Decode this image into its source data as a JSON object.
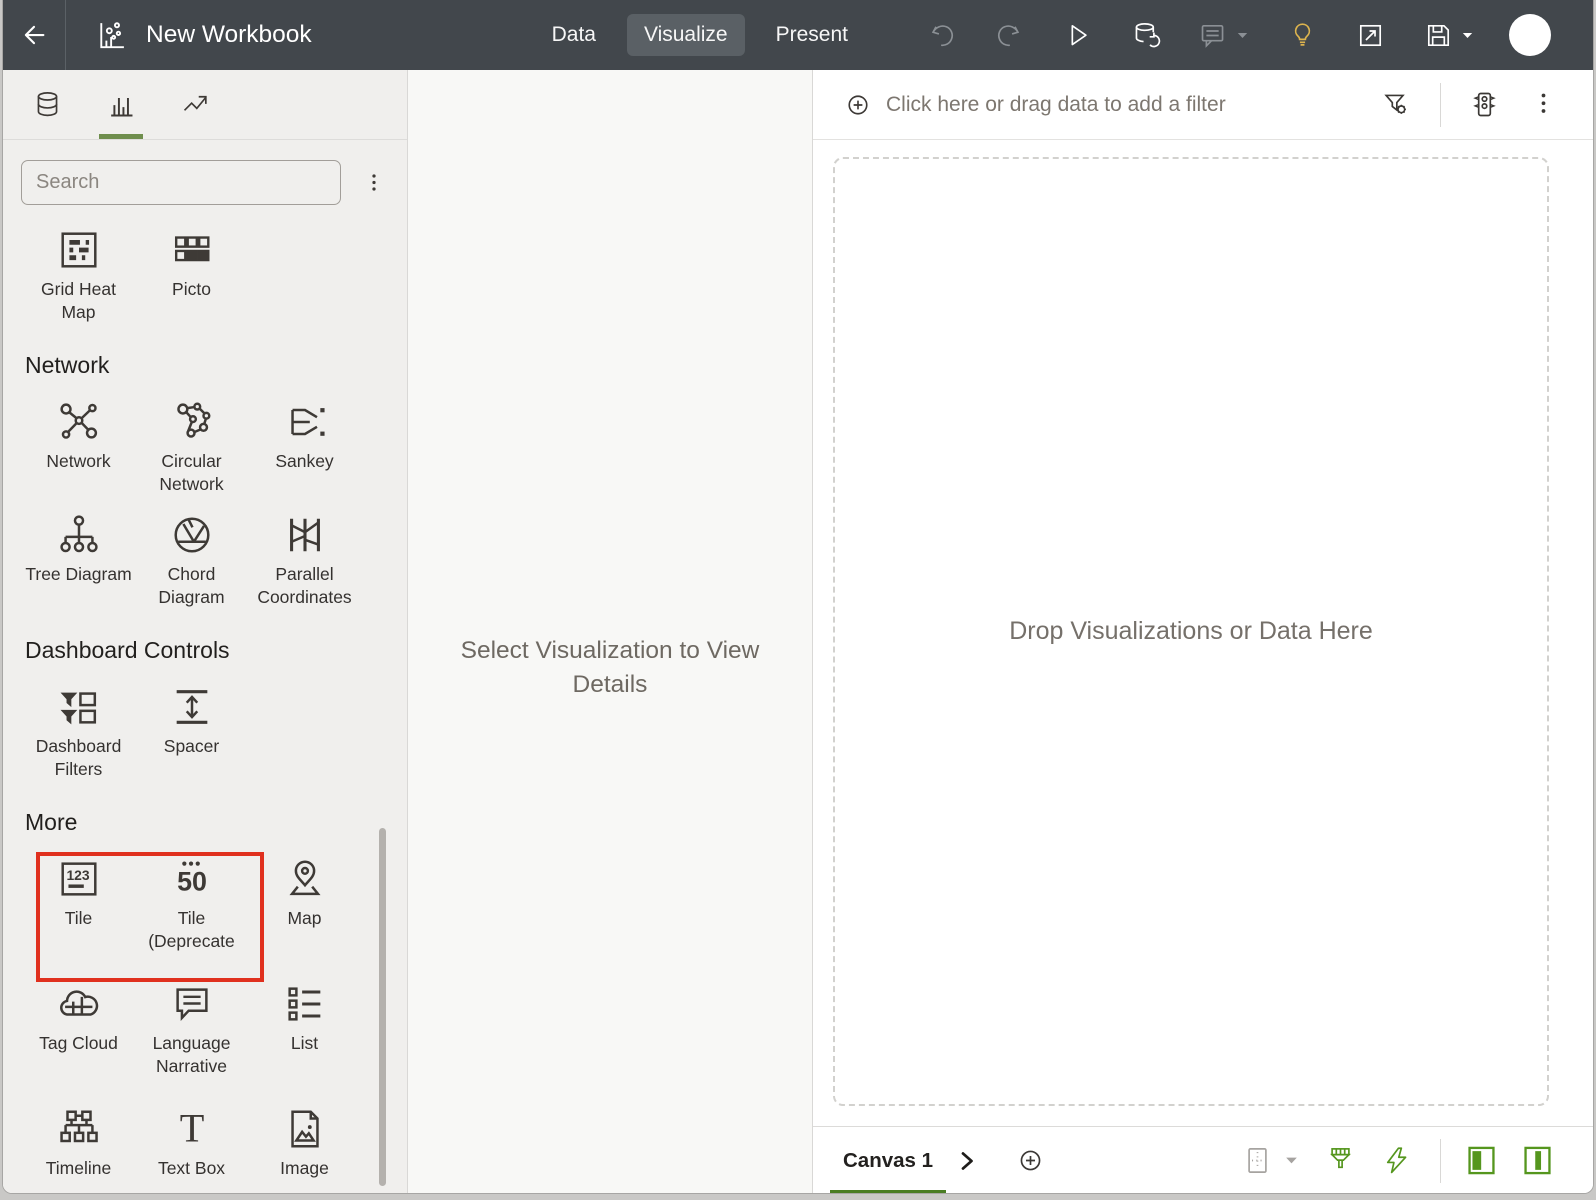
{
  "colors": {
    "topbar_bg": "#42474c",
    "accent_green": "#4a7d23",
    "sidebar_tab_green": "#6f8e4d",
    "toolbar_green": "#55961e",
    "highlight_red": "#e0301e",
    "insight_yellow": "#ddb44e"
  },
  "topbar": {
    "title": "New Workbook",
    "tabs": [
      {
        "label": "Data",
        "selected": false
      },
      {
        "label": "Visualize",
        "selected": true
      },
      {
        "label": "Present",
        "selected": false
      }
    ],
    "actions": [
      {
        "icon": "undo",
        "enabled": false
      },
      {
        "icon": "redo",
        "enabled": false
      },
      {
        "icon": "run",
        "enabled": true
      },
      {
        "icon": "refresh-data",
        "enabled": true
      },
      {
        "icon": "comment",
        "enabled": false,
        "caret": true
      },
      {
        "icon": "insight",
        "enabled": true,
        "yellow": true
      },
      {
        "icon": "open-window",
        "enabled": true
      },
      {
        "icon": "save",
        "enabled": true,
        "caret": true
      }
    ]
  },
  "sidebar": {
    "tabs": [
      {
        "icon": "data-panel",
        "selected": false
      },
      {
        "icon": "visualizations",
        "selected": true
      },
      {
        "icon": "analytics",
        "selected": false
      }
    ],
    "search_placeholder": "Search",
    "sections": [
      {
        "heading": "",
        "items": [
          {
            "label": "Grid Heat Map",
            "icon": "grid-heat-map"
          },
          {
            "label": "Picto",
            "icon": "picto"
          }
        ]
      },
      {
        "heading": "Network",
        "items": [
          {
            "label": "Network",
            "icon": "network"
          },
          {
            "label": "Circular Network",
            "icon": "circular-network"
          },
          {
            "label": "Sankey",
            "icon": "sankey"
          },
          {
            "label": "Tree Diagram",
            "icon": "tree-diagram"
          },
          {
            "label": "Chord Diagram",
            "icon": "chord-diagram"
          },
          {
            "label": "Parallel Coordinates",
            "icon": "parallel-coordinates"
          }
        ]
      },
      {
        "heading": "Dashboard Controls",
        "items": [
          {
            "label": "Dashboard Filters",
            "icon": "dashboard-filters"
          },
          {
            "label": "Spacer",
            "icon": "spacer"
          }
        ]
      },
      {
        "heading": "More",
        "highlight_box": true,
        "items": [
          {
            "label": "Tile",
            "icon": "tile"
          },
          {
            "label": "Tile (Deprecate",
            "icon": "tile-deprecated"
          },
          {
            "label": "Map",
            "icon": "map"
          },
          {
            "label": "Tag Cloud",
            "icon": "tag-cloud"
          },
          {
            "label": "Language Narrative",
            "icon": "language-narrative"
          },
          {
            "label": "List",
            "icon": "list"
          },
          {
            "label": "Timeline",
            "icon": "timeline"
          },
          {
            "label": "Text Box",
            "icon": "text-box"
          },
          {
            "label": "Image",
            "icon": "image"
          }
        ]
      }
    ]
  },
  "detail_panel": {
    "placeholder": "Select Visualization to View Details"
  },
  "filter_bar": {
    "placeholder": "Click here or drag data to add a filter",
    "icons": [
      {
        "icon": "filter-settings"
      },
      {
        "divider": true
      },
      {
        "icon": "data-quality"
      },
      {
        "icon": "kebab"
      }
    ]
  },
  "canvas": {
    "placeholder": "Drop Visualizations or Data Here",
    "tab_label": "Canvas 1",
    "tools": [
      {
        "icon": "canvas-layout",
        "tone": "gray"
      },
      {
        "icon": "caret-down",
        "tone": "gray",
        "small": true
      },
      {
        "icon": "brush",
        "tone": "green"
      },
      {
        "icon": "bolt",
        "tone": "green"
      },
      {
        "divider": true
      },
      {
        "icon": "panel-left",
        "tone": "green"
      },
      {
        "icon": "panel-right",
        "tone": "green"
      }
    ]
  }
}
